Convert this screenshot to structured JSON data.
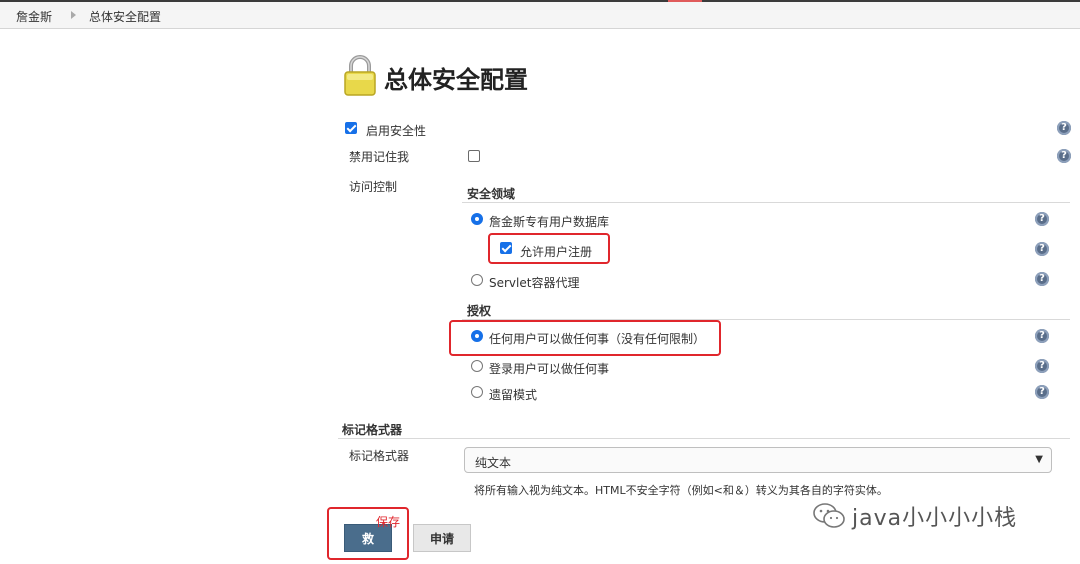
{
  "breadcrumb": {
    "home": "詹金斯",
    "current": "总体安全配置"
  },
  "page": {
    "title": "总体安全配置"
  },
  "security": {
    "enable_label": "启用安全性",
    "enable_checked": true,
    "disable_remember_label": "禁用记住我",
    "disable_remember_checked": false,
    "access_control_label": "访问控制"
  },
  "realm": {
    "heading": "安全领域",
    "options": [
      {
        "label": "詹金斯专有用户数据库",
        "selected": true
      },
      {
        "label": "Servlet容器代理",
        "selected": false
      }
    ],
    "allow_signup_label": "允许用户注册",
    "allow_signup_checked": true
  },
  "authorization": {
    "heading": "授权",
    "options": [
      {
        "label": "任何用户可以做任何事（没有任何限制）",
        "selected": true
      },
      {
        "label": "登录用户可以做任何事",
        "selected": false
      },
      {
        "label": "遗留模式",
        "selected": false
      }
    ]
  },
  "markup": {
    "section_heading": "标记格式器",
    "field_label": "标记格式器",
    "selected_value": "纯文本",
    "description": "将所有输入视为纯文本。HTML不安全字符（例如<和＆）转义为其各自的字符实体。"
  },
  "buttons": {
    "save_label": "救",
    "apply_label": "申请"
  },
  "annotation": {
    "save_text": "保存"
  },
  "watermark": {
    "text": "java小小小小栈"
  },
  "colors": {
    "accent": "#1670e8",
    "highlight": "#e0262c",
    "save_button": "#4a6d8c"
  }
}
